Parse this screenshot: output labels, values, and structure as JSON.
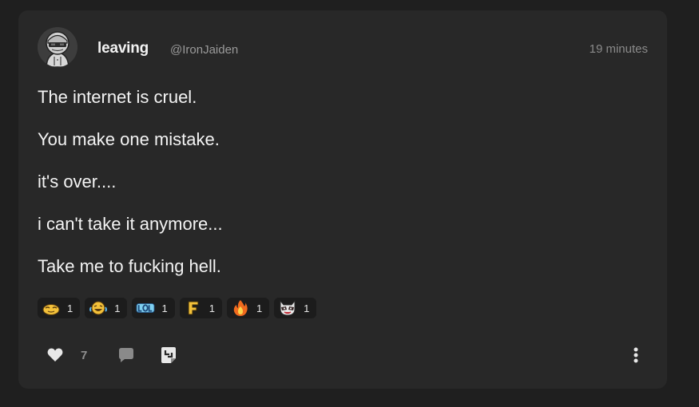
{
  "post": {
    "author": {
      "display_name": "leaving",
      "handle": "@IronJaiden",
      "avatar_icon": "hooded-character-avatar"
    },
    "timestamp": "19 minutes",
    "lines": [
      "The internet is cruel.",
      "You make one mistake.",
      "it's over....",
      "i can't take it anymore...",
      "Take me to fucking hell."
    ],
    "reactions": [
      {
        "icon": "relieved-face-emoji",
        "count": "1"
      },
      {
        "icon": "crying-laughing-face-emoji",
        "count": "1"
      },
      {
        "icon": "lol-text-emoji",
        "count": "1"
      },
      {
        "icon": "letter-f-emoji",
        "count": "1"
      },
      {
        "icon": "fire-emoji",
        "count": "1"
      },
      {
        "icon": "raccoon-face-emoji",
        "count": "1"
      }
    ],
    "actions": {
      "like_count": "7",
      "like_icon": "heart-icon",
      "comment_icon": "speech-bubble-icon",
      "repost_icon": "repost-icon",
      "more_icon": "vertical-ellipsis-icon"
    }
  },
  "colors": {
    "page_background": "#1f1f1f",
    "card_background": "#282828",
    "chip_background": "#1c1c1c",
    "text_primary": "#f4f4f4",
    "text_secondary": "#8a8a8a"
  }
}
